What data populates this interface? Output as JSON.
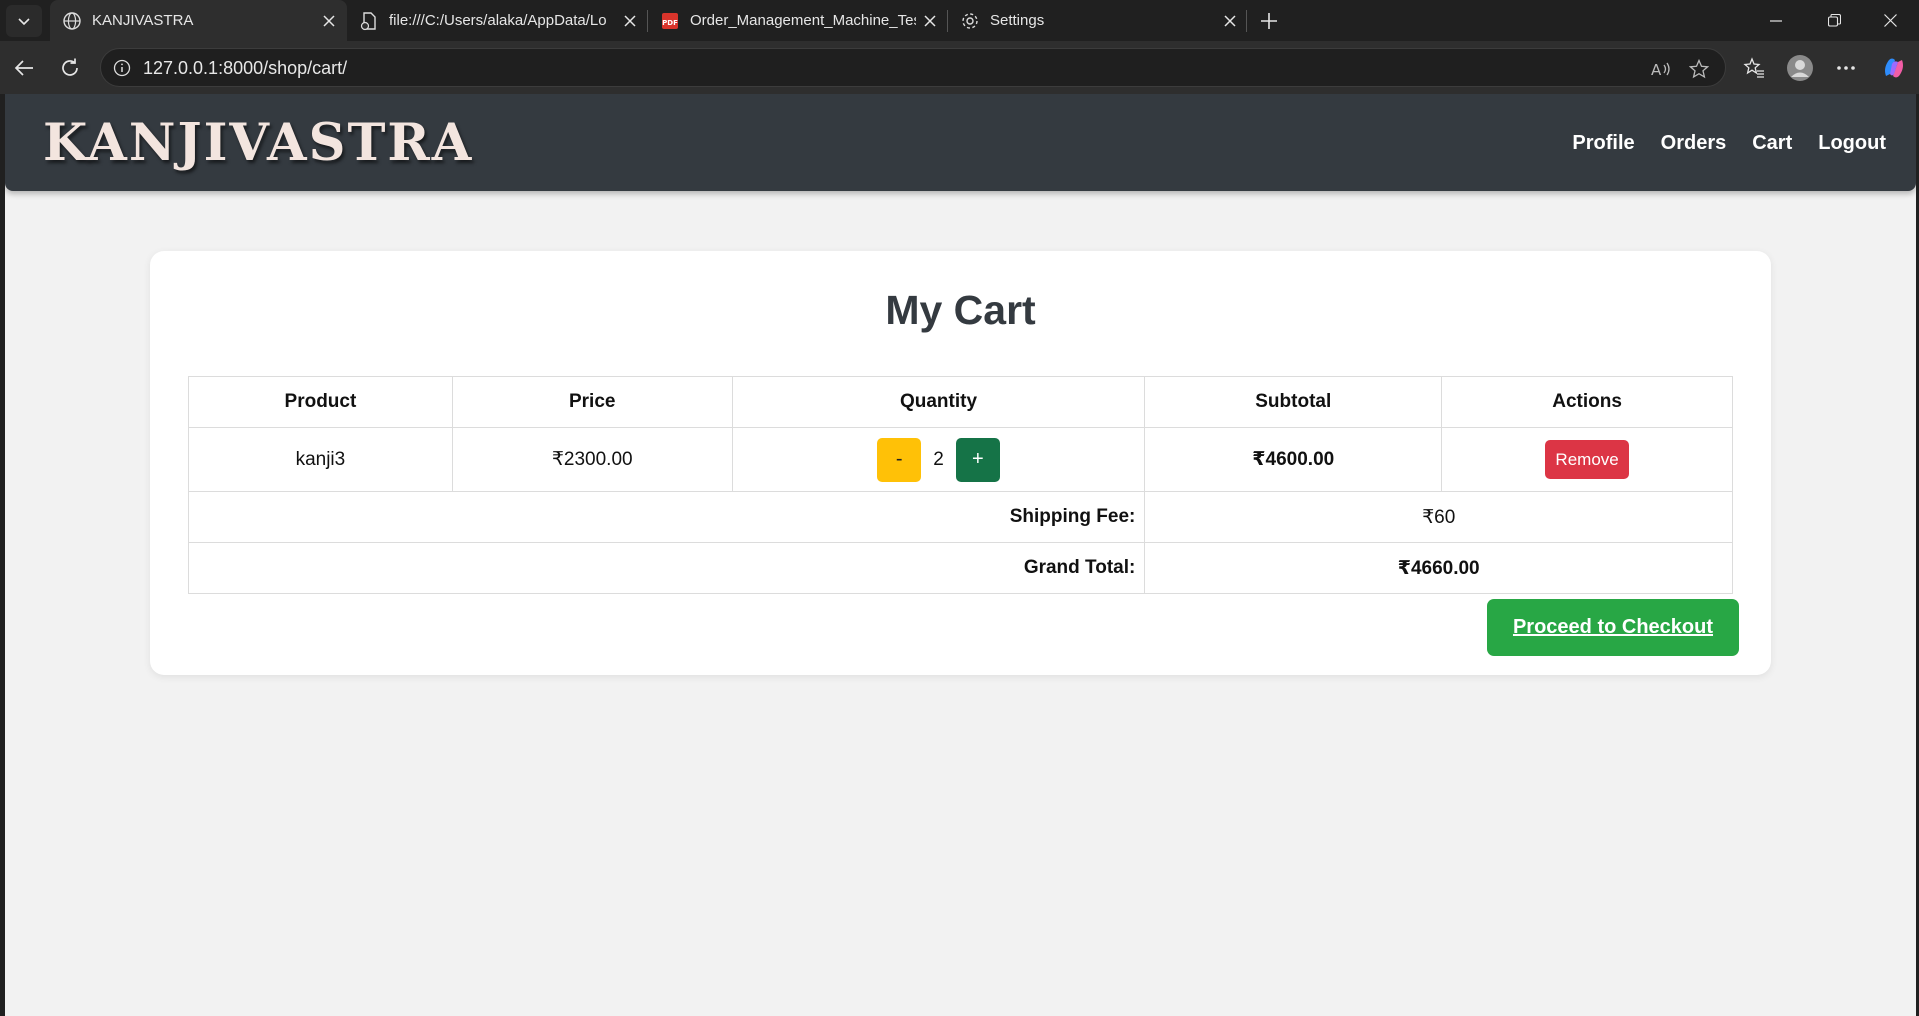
{
  "browser": {
    "tabs": [
      {
        "title": "KANJIVASTRA",
        "icon": "globe-icon",
        "active": true
      },
      {
        "title": "file:///C:/Users/alaka/AppData/Lo",
        "icon": "file-icon",
        "active": false
      },
      {
        "title": "Order_Management_Machine_Tes",
        "icon": "pdf-icon",
        "active": false
      },
      {
        "title": "Settings",
        "icon": "gear-icon",
        "active": false
      }
    ],
    "url": "127.0.0.1:8000/shop/cart/",
    "colors": {
      "chrome": "#202020",
      "toolbar": "#2e2e2e"
    }
  },
  "site": {
    "brand": "KANJIVASTRA",
    "nav": [
      "Profile",
      "Orders",
      "Cart",
      "Logout"
    ],
    "colors": {
      "header": "#343a40",
      "page_bg": "#f2f2f2"
    }
  },
  "cart": {
    "title": "My Cart",
    "columns": [
      "Product",
      "Price",
      "Quantity",
      "Subtotal",
      "Actions"
    ],
    "items": [
      {
        "product": "kanji3",
        "price": "₹2300.00",
        "minus": "-",
        "quantity": "2",
        "plus": "+",
        "subtotal": "₹4600.00",
        "action": "Remove"
      }
    ],
    "shipping_label": "Shipping Fee:",
    "shipping_value": "₹60",
    "total_label": "Grand Total:",
    "total_value": "₹4660.00",
    "checkout_label": "Proceed to Checkout",
    "colors": {
      "minus": "#ffc107",
      "plus": "#157347",
      "remove": "#dc3545",
      "checkout": "#28a745"
    }
  }
}
